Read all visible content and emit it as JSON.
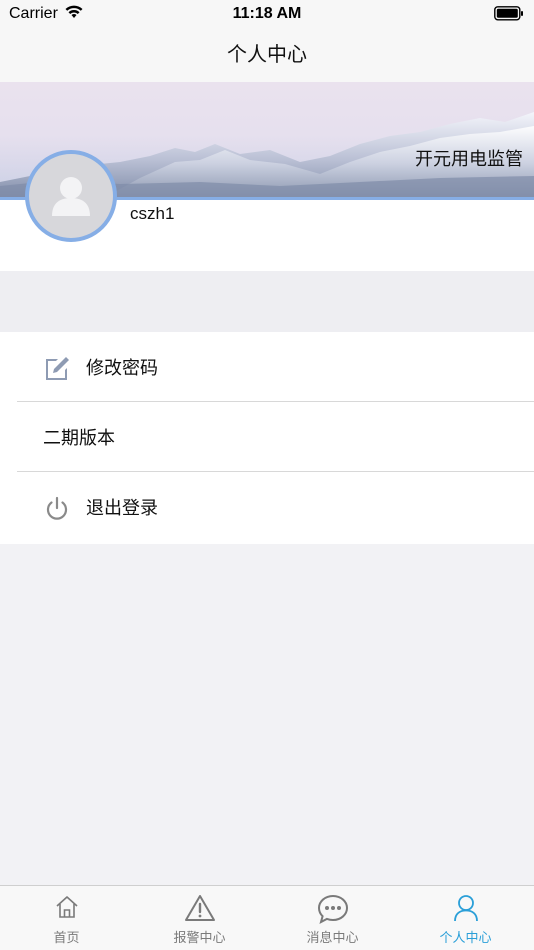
{
  "status_bar": {
    "carrier": "Carrier",
    "time": "11:18 AM"
  },
  "nav": {
    "title": "个人中心"
  },
  "header": {
    "app_name": "开元用电监管",
    "username": "cszh1"
  },
  "menu": {
    "items": [
      {
        "label": "修改密码",
        "icon": "edit-icon"
      },
      {
        "label": "二期版本",
        "icon": ""
      },
      {
        "label": "退出登录",
        "icon": "power-icon"
      }
    ]
  },
  "tabs": [
    {
      "label": "首页",
      "icon": "home-icon",
      "active": false
    },
    {
      "label": "报警中心",
      "icon": "warning-icon",
      "active": false
    },
    {
      "label": "消息中心",
      "icon": "message-icon",
      "active": false
    },
    {
      "label": "个人中心",
      "icon": "user-icon",
      "active": true
    }
  ],
  "colors": {
    "accent": "#2a9fd8",
    "avatar_ring": "#86aee6",
    "inactive_tab": "#7a7a7a"
  }
}
